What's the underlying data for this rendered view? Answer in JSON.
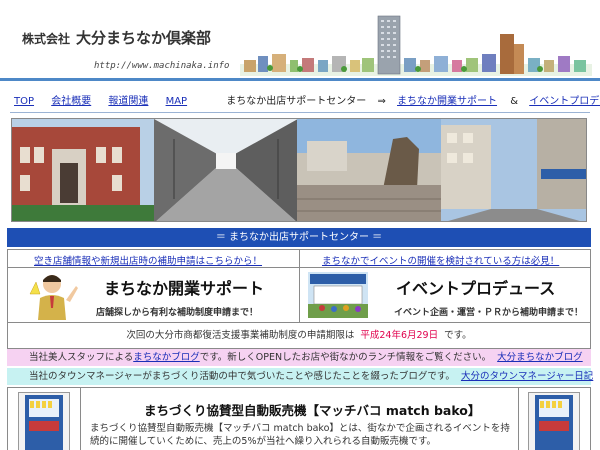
{
  "header": {
    "company_prefix": "株式会社",
    "company_name": "大分まちなか倶楽部",
    "url": "http://www.machinaka.info"
  },
  "nav": {
    "items": [
      {
        "label": "TOP"
      },
      {
        "label": "会社概要"
      },
      {
        "label": "報道関連"
      },
      {
        "label": "MAP"
      }
    ],
    "center_label": "まちなか出店サポートセンター",
    "arrow": "⇒",
    "link_kaigyo": "まちなか開業サポート",
    "amp": "&",
    "link_event": "イベントプロデュース"
  },
  "banner": {
    "text": "＝ まちなか出店サポートセンター ＝"
  },
  "boxes": {
    "left_link": "空き店舗情報や新規出店時の補助申請はこちらから！",
    "right_link": "まちなかでイベントの開催を検討されている方は必見！",
    "left_title": "まちなか開業サポート",
    "left_sub": "店舗探しから有利な補助制度申請まで！",
    "right_title": "イベントプロデュース",
    "right_sub": "イベント企画・運営・ＰＲから補助申請まで！",
    "deadline_text": "次回の大分市商都復活支援事業補助制度の申請期限は",
    "deadline_date": "平成24年6月29日",
    "deadline_tail": "です。"
  },
  "pink_row": {
    "prefix": "当社美人スタッフによる",
    "link": "まちなかブログ",
    "middle": "です。新しくOPENしたお店や街なかのランチ情報をご覧ください。",
    "link2": "大分まちなかブログ"
  },
  "cyan_row": {
    "prefix": "当社のタウンマネージャーがまちづくり活動の中で気づいたことや感じたことを綴ったブログです。",
    "link": "大分のタウンマネージャー日記"
  },
  "vending": {
    "title": "まちづくり協賛型自動販売機【マッチバコ match bako】",
    "body": "まちづくり協賛型自動販売機【マッチバコ match bako】とは、街なかで企画されるイベントを持続的に開催していくために、売上の5%が当社へ繰り入れられる自動販売機です。"
  },
  "colors": {
    "header_rule": "#4e88c7",
    "banner": "#1e4fb4",
    "link": "#1a2fb8",
    "deadline_date": "#e0004c",
    "pink_row": "#f6d2f2",
    "cyan_row": "#c7f2f2"
  }
}
